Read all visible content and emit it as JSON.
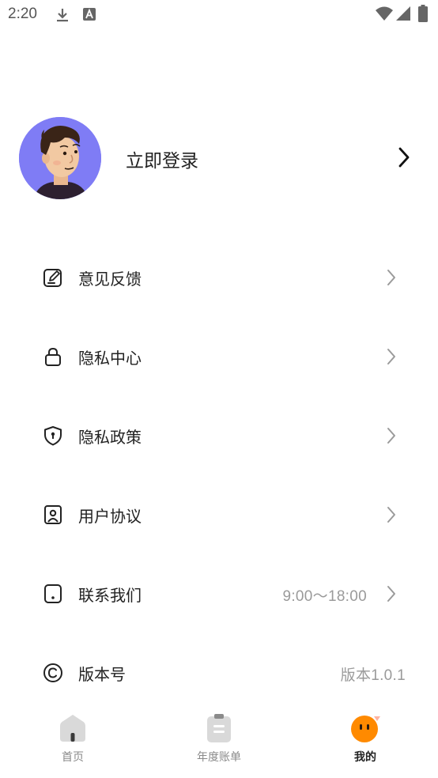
{
  "status_bar": {
    "time": "2:20",
    "icons": [
      "download-icon",
      "text-a-icon",
      "wifi-icon",
      "signal-icon",
      "battery-icon"
    ]
  },
  "profile": {
    "login_label": "立即登录",
    "avatar_colors": {
      "background": "#7f7cf5",
      "hair": "#3a2417",
      "skin": "#f2c9a2",
      "shirt": "#2d2030"
    }
  },
  "menu": {
    "items": [
      {
        "label": "意见反馈",
        "icon": "feedback-icon"
      },
      {
        "label": "隐私中心",
        "icon": "lock-icon"
      },
      {
        "label": "隐私政策",
        "icon": "shield-icon"
      },
      {
        "label": "用户协议",
        "icon": "user-agreement-icon"
      },
      {
        "label": "联系我们",
        "icon": "phone-icon",
        "value": "9:00～18:00"
      },
      {
        "label": "版本号",
        "icon": "copyright-icon",
        "value": "版本1.0.1"
      }
    ]
  },
  "bottom_nav": {
    "tabs": [
      {
        "label": "首页",
        "icon": "home-icon",
        "active": false
      },
      {
        "label": "年度账单",
        "icon": "bill-icon",
        "active": false
      },
      {
        "label": "我的",
        "icon": "mine-face-icon",
        "active": true
      }
    ],
    "accent": "#ff8a00",
    "inactive_icon_color": "#d9d9d9"
  }
}
